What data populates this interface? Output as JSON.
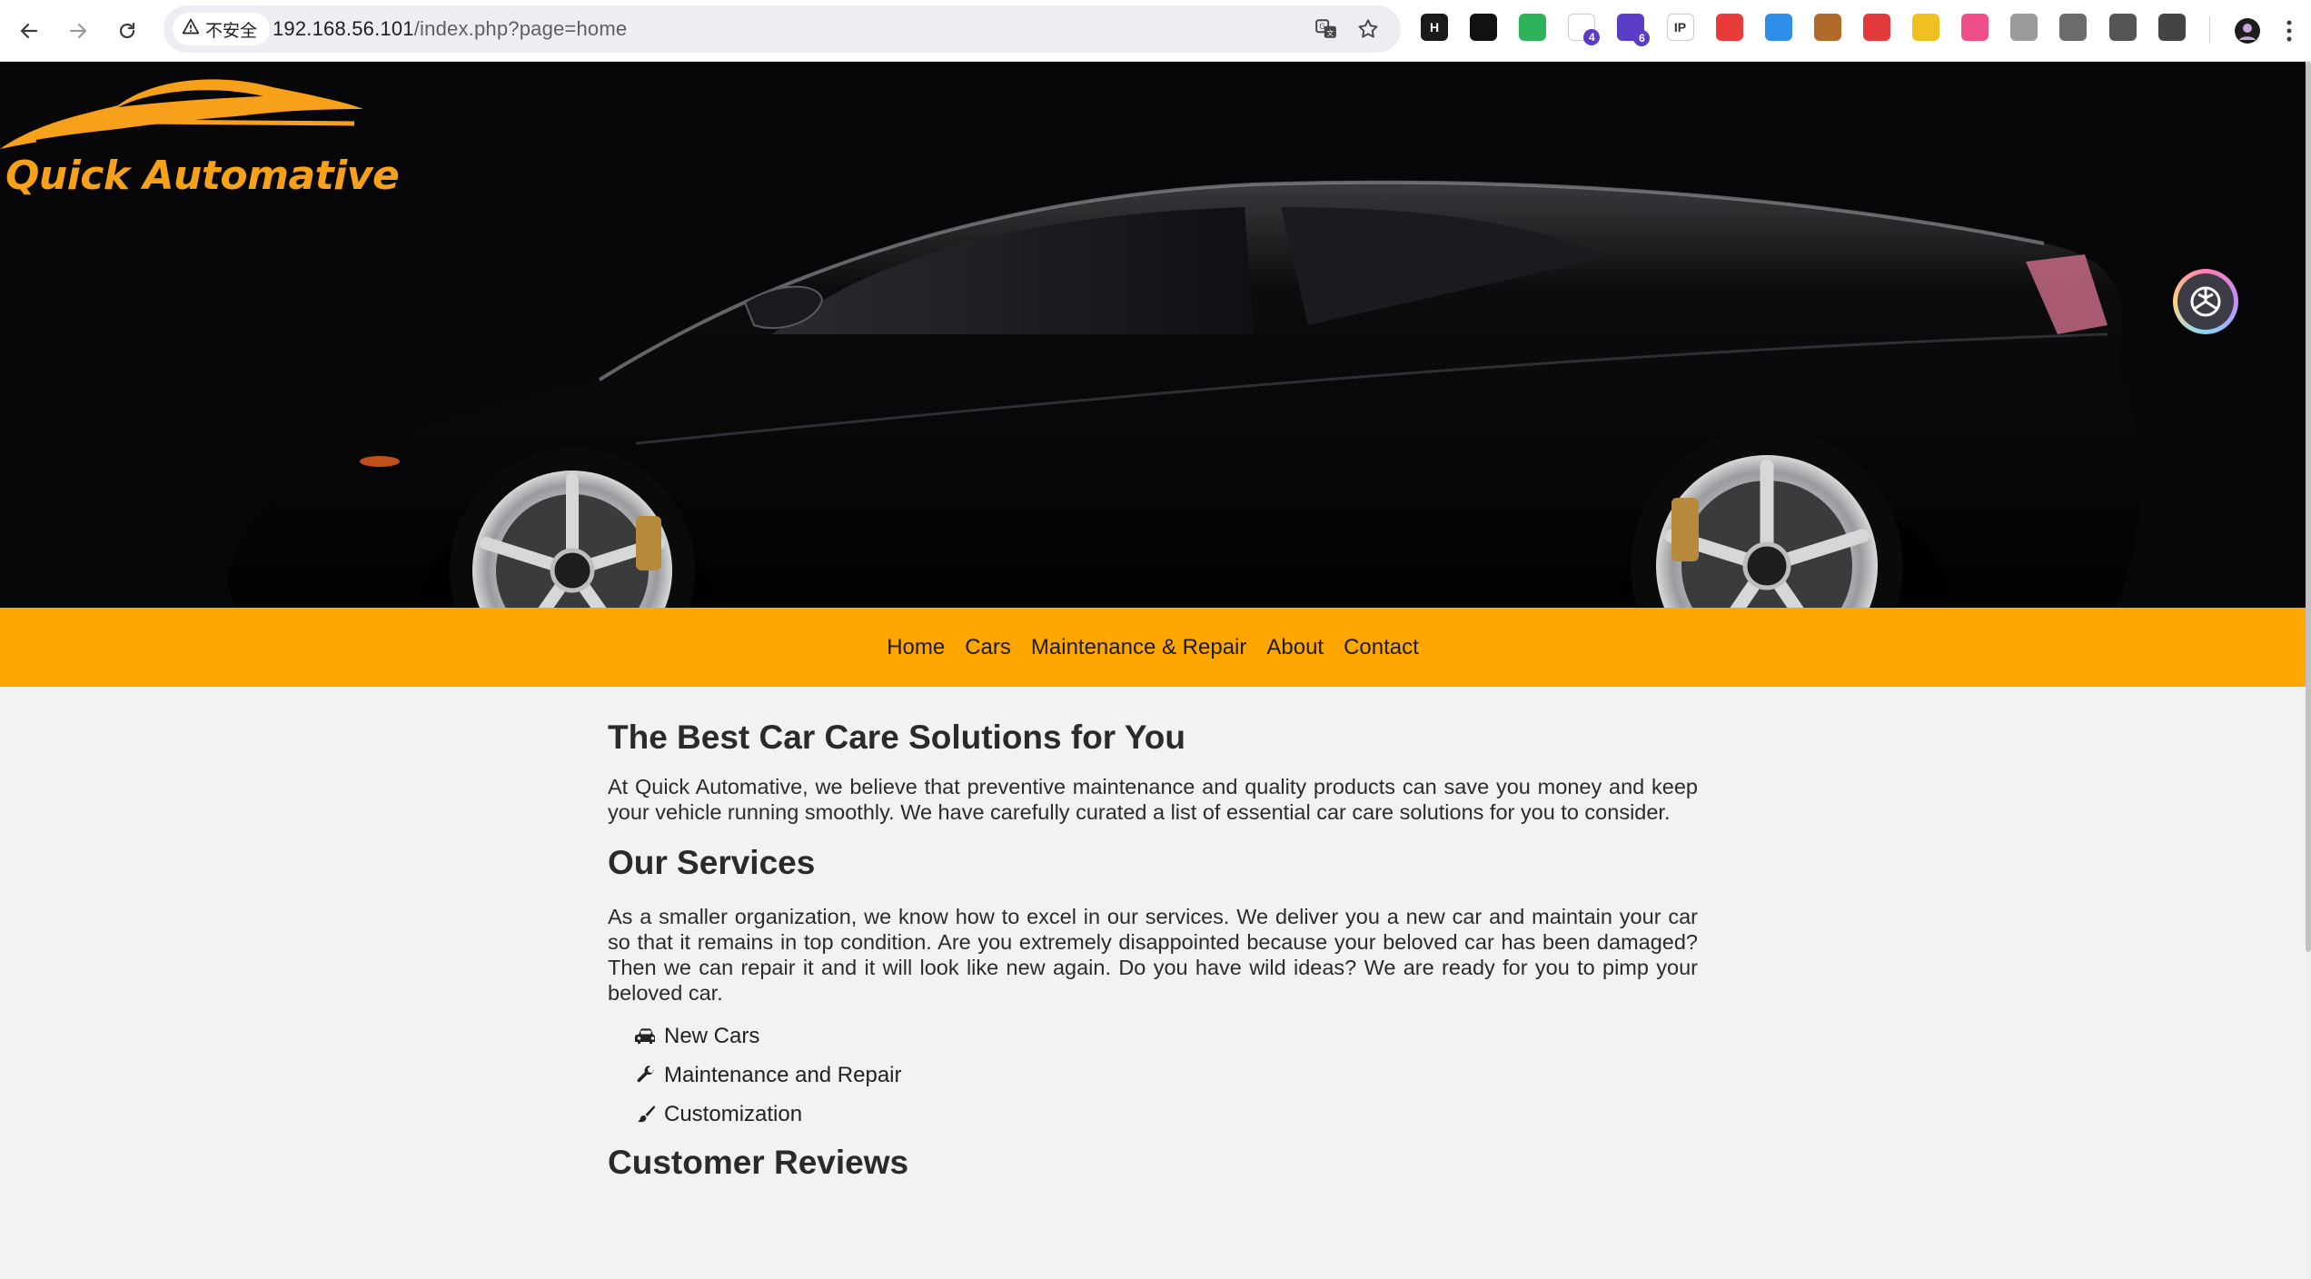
{
  "browser": {
    "security_label": "不安全",
    "url_host": "192.168.56.101",
    "url_path": "/index.php?page=home",
    "extensions": [
      {
        "name": "h-ext",
        "label": "H",
        "bg": "#1a1a1a"
      },
      {
        "name": "circle-ext",
        "label": "",
        "bg": "#111111"
      },
      {
        "name": "shield-ext",
        "label": "",
        "bg": "#2fb35a"
      },
      {
        "name": "filter-ext",
        "label": "",
        "bg": "#ffffff",
        "badge": "4"
      },
      {
        "name": "cube-ext",
        "label": "",
        "bg": "#5b3cc4",
        "badge": "6"
      },
      {
        "name": "ip-ext",
        "label": "IP",
        "bg": "#ffffff"
      },
      {
        "name": "red-ext",
        "label": "",
        "bg": "#e83b3b"
      },
      {
        "name": "eye-ext",
        "label": "",
        "bg": "#2f8fe8"
      },
      {
        "name": "cookie-ext",
        "label": "",
        "bg": "#b06a2c"
      },
      {
        "name": "pokeball-ext",
        "label": "",
        "bg": "#e23a3a"
      },
      {
        "name": "key-ext",
        "label": "",
        "bg": "#f0c020"
      },
      {
        "name": "translate-ext",
        "label": "",
        "bg": "#ee4f8a"
      },
      {
        "name": "lang-ext",
        "label": "",
        "bg": "#9a9a9a"
      },
      {
        "name": "recycle-ext",
        "label": "",
        "bg": "#6b6b6b"
      },
      {
        "name": "hat-ext",
        "label": "",
        "bg": "#555555"
      },
      {
        "name": "puzzle-ext",
        "label": "",
        "bg": "#444444"
      }
    ]
  },
  "site": {
    "brand_name": "Quick Automative",
    "brand_color": "#f7a11a",
    "accent_color": "#ffa700"
  },
  "nav": {
    "items": [
      "Home",
      "Cars",
      "Maintenance & Repair",
      "About",
      "Contact"
    ]
  },
  "main": {
    "heading1": "The Best Car Care Solutions for You",
    "intro": "At Quick Automative, we believe that preventive maintenance and quality products can save you money and keep your vehicle running smoothly. We have carefully curated a list of essential car care solutions for you to consider.",
    "services_heading": "Our Services",
    "services_text": "As a smaller organization, we know how to excel in our services. We deliver you a new car and maintain your car so that it remains in top condition. Are you extremely disappointed because your beloved car has been damaged? Then we can repair it and it will look like new again. Do you have wild ideas? We are ready for you to pimp your beloved car.",
    "services": [
      {
        "icon": "car-icon",
        "label": "New Cars"
      },
      {
        "icon": "wrench-icon",
        "label": "Maintenance and Repair"
      },
      {
        "icon": "brush-icon",
        "label": "Customization"
      }
    ],
    "reviews_heading": "Customer Reviews"
  }
}
